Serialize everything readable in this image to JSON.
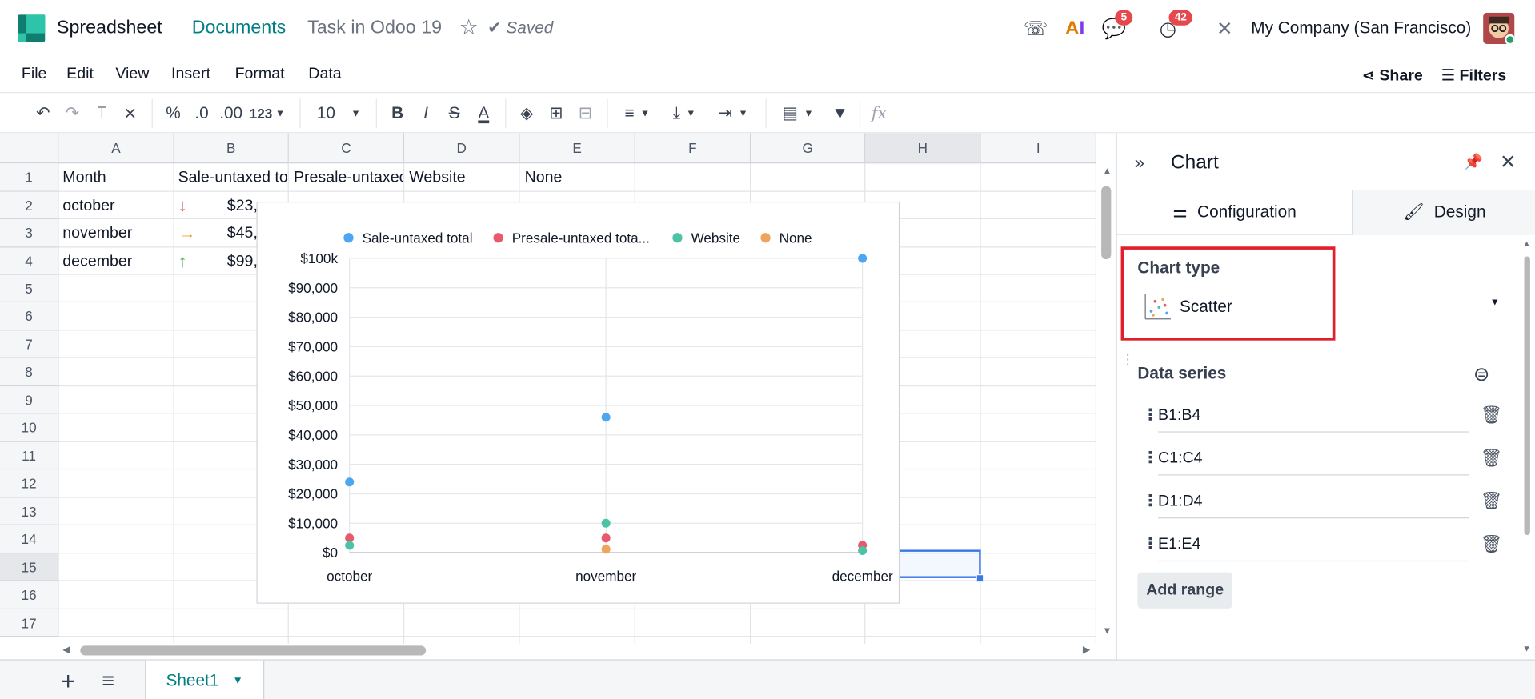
{
  "header": {
    "app_title": "Spreadsheet",
    "breadcrumb_parent": "Documents",
    "document_name": "Task in Odoo 19",
    "saved_label": "Saved",
    "chat_badge": "5",
    "activity_badge": "42",
    "company": "My Company (San Francisco)"
  },
  "menu": {
    "items": [
      "File",
      "Edit",
      "View",
      "Insert",
      "Format",
      "Data"
    ],
    "share_label": "Share",
    "filters_label": "Filters"
  },
  "toolbar": {
    "percent": "%",
    "dec_decrease": ".0",
    "dec_increase": ".00",
    "number_format": "123",
    "font_size": "10",
    "bold": "B",
    "italic": "I",
    "strike": "S",
    "text_color": "A",
    "fx": "fx"
  },
  "grid": {
    "columns": [
      "A",
      "B",
      "C",
      "D",
      "E",
      "F",
      "G",
      "H",
      "I"
    ],
    "rows": [
      "1",
      "2",
      "3",
      "4",
      "5",
      "6",
      "7",
      "8",
      "9",
      "10",
      "11",
      "12",
      "13",
      "14",
      "15",
      "16",
      "17"
    ],
    "header_row": [
      "Month",
      "Sale-untaxed to",
      "Presale-untaxec",
      "Website",
      "None"
    ],
    "data": [
      {
        "month": "october",
        "b": "$23,"
      },
      {
        "month": "november",
        "b": "$45,"
      },
      {
        "month": "december",
        "b": "$99,"
      }
    ],
    "selected_row": "15",
    "selected_col": "H"
  },
  "chart_data": {
    "type": "scatter",
    "title": "",
    "xlabel": "",
    "ylabel": "",
    "categories": [
      "october",
      "november",
      "december"
    ],
    "ylim": [
      0,
      100000
    ],
    "y_ticks": [
      "$0",
      "$10,000",
      "$20,000",
      "$30,000",
      "$40,000",
      "$50,000",
      "$60,000",
      "$70,000",
      "$80,000",
      "$90,000",
      "$100k"
    ],
    "legend_position": "top",
    "grid": true,
    "series": [
      {
        "name": "Sale-untaxed total",
        "values": [
          24000,
          46000,
          100000
        ],
        "color": "#4ea5f2"
      },
      {
        "name": "Presale-untaxed tota...",
        "values": [
          5000,
          5000,
          2500
        ],
        "color": "#e8596b"
      },
      {
        "name": "Website",
        "values": [
          2500,
          10000,
          700
        ],
        "color": "#4cc3a6"
      },
      {
        "name": "None",
        "values": [
          null,
          1200,
          null
        ],
        "color": "#f0a35c"
      }
    ]
  },
  "panel": {
    "title": "Chart",
    "tab_config": "Configuration",
    "tab_design": "Design",
    "chart_type_label": "Chart type",
    "chart_type_value": "Scatter",
    "data_series_label": "Data series",
    "ranges": [
      "B1:B4",
      "C1:C4",
      "D1:D4",
      "E1:E4"
    ],
    "add_range": "Add range"
  },
  "sheets": {
    "active": "Sheet1"
  },
  "colors": {
    "accent": "#017e84",
    "highlight": "#e0202c",
    "selection": "#3b78e7"
  }
}
